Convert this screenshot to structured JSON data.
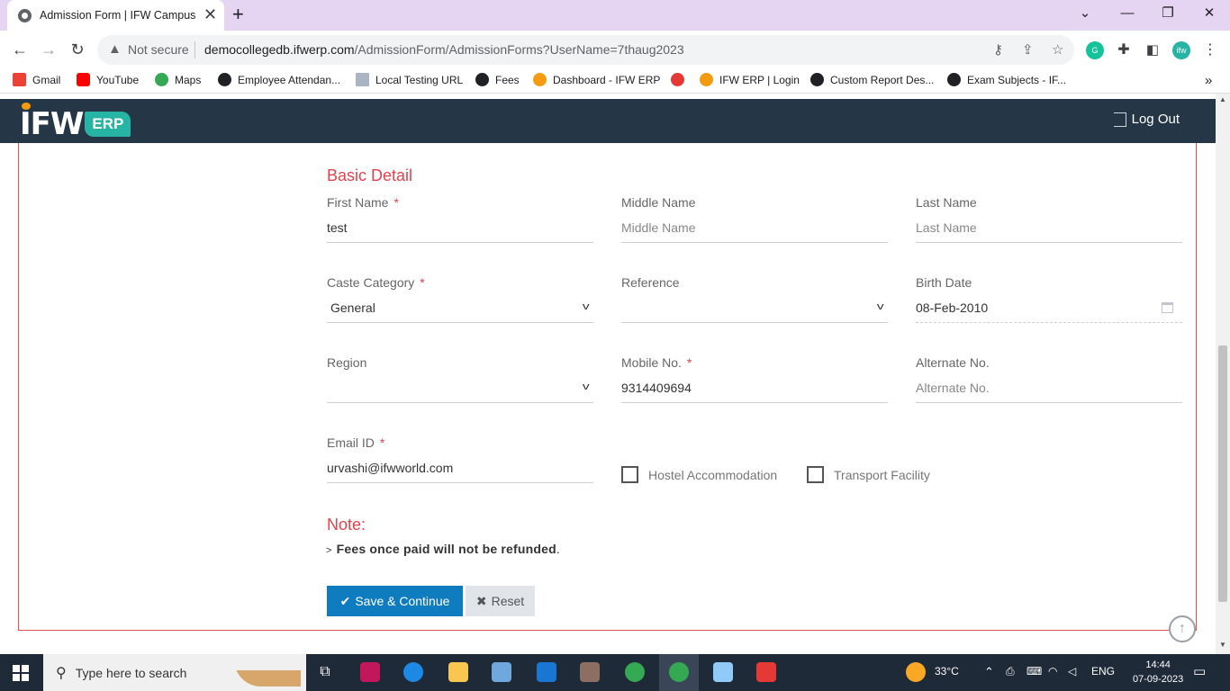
{
  "browser": {
    "tab_title": "Admission Form | IFW Campus",
    "tab_close": "✕",
    "new_tab": "+",
    "not_secure": "Not secure",
    "url_host": "democollegedb.ifwerp.com",
    "url_path": "/AdmissionForm/AdmissionForms?UserName=7thaug2023",
    "bookmarks": [
      "Gmail",
      "YouTube",
      "Maps",
      "Employee Attendan...",
      "Local Testing URL",
      "Fees",
      "Dashboard - IFW ERP",
      "",
      "IFW ERP | Login",
      "Custom Report Des...",
      "Exam Subjects - IF..."
    ],
    "bookmark_overflow": "»"
  },
  "header": {
    "logo_text": "IFW",
    "logo_badge": "ERP",
    "logout_label": "Log Out"
  },
  "form": {
    "section_title": "Basic Detail",
    "first_name": {
      "label": "First Name",
      "required": "*",
      "value": "test"
    },
    "middle_name": {
      "label": "Middle Name",
      "placeholder": "Middle Name"
    },
    "last_name": {
      "label": "Last Name",
      "placeholder": "Last Name"
    },
    "caste_category": {
      "label": "Caste Category",
      "required": "*",
      "value": "General"
    },
    "reference": {
      "label": "Reference",
      "value": ""
    },
    "birth_date": {
      "label": "Birth Date",
      "value": "08-Feb-2010"
    },
    "region": {
      "label": "Region",
      "value": ""
    },
    "mobile_no": {
      "label": "Mobile No.",
      "required": "*",
      "value": "9314409694"
    },
    "alternate_no": {
      "label": "Alternate No.",
      "placeholder": "Alternate No."
    },
    "email_id": {
      "label": "Email ID",
      "required": "*",
      "value": "urvashi@ifwworld.com"
    },
    "hostel_label": "Hostel Accommodation",
    "transport_label": "Transport Facility",
    "note_title": "Note:",
    "note_text": "Fees once paid will not be refunded",
    "note_period": ".",
    "save_button": "Save & Continue",
    "reset_button": "Reset"
  },
  "taskbar": {
    "search_placeholder": "Type here to search",
    "weather": "33°C",
    "language": "ENG",
    "time": "14:44",
    "date": "07-09-2023"
  }
}
